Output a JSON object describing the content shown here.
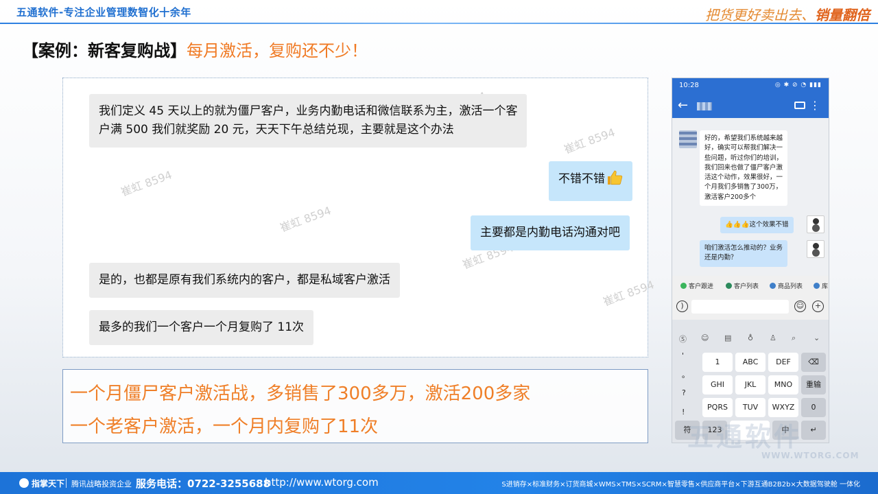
{
  "header": {
    "brand": "五通软件-专注企业管理数智化十余年",
    "slogan_normal": "把货更好卖出去、",
    "slogan_bold": "销量翻倍",
    "title_main": "【案例：新客复购战】",
    "title_sub": "每月激活，复购还不少！"
  },
  "chat": {
    "messages": [
      {
        "side": "left",
        "lines": [
          "我们定义 45 天以上的就为僵尸客户，业务内勤电话和微信联系为主，激活一个客",
          "户满 500 我们就奖励 20 元，天天下午总结兑现，主要就是这个办法"
        ]
      },
      {
        "side": "right",
        "lines": [
          "不错不错"
        ],
        "emoji": "thumbs-up"
      },
      {
        "side": "right",
        "lines": [
          "主要都是内勤电话沟通对吧"
        ]
      },
      {
        "side": "left",
        "lines": [
          "是的，也都是原有我们系统内的客户，都是私域客户激活"
        ]
      },
      {
        "side": "left",
        "lines": [
          "最多的我们一个客户一个月复购了 11次"
        ]
      }
    ],
    "watermark": "崔虹 8594"
  },
  "summary": {
    "line1": "一个月僵尸客户激活战，多销售了300多万，激活200多家",
    "line2": "一个老客户激活，一个月内复购了11次"
  },
  "phone": {
    "status_time": "10:28",
    "status_icons": "◎ ✱ ⊘ ◔ ▮▮▮",
    "messages": [
      {
        "side": "left",
        "lines": [
          "好的，希望我们系统越来越",
          "好，确实可以帮我们解决一",
          "些问题，听过你们的培训，",
          "我们回来也做了僵尸客户激",
          "活这个动作，效果很好，一",
          "个月我们多销售了300万，",
          "激活客户200多个"
        ]
      },
      {
        "side": "right",
        "lines": [
          "👍👍👍这个效果不错"
        ]
      },
      {
        "side": "right",
        "lines": [
          "咱们激活怎么推动的？业务",
          "还是内勤？"
        ]
      }
    ],
    "actions": [
      "客户跟进",
      "客户列表",
      "商品列表",
      "库"
    ],
    "keyboard": {
      "punct": [
        "'",
        "。",
        "?",
        "!"
      ],
      "row1": [
        "1",
        "ABC",
        "DEF"
      ],
      "row2": [
        "GHI",
        "JKL",
        "MNO"
      ],
      "row3": [
        "PQRS",
        "TUV",
        "WXYZ"
      ],
      "bottom": [
        "符",
        "123",
        "中",
        "↵"
      ],
      "side_keys": [
        "⌫",
        "重输",
        "0"
      ]
    }
  },
  "footer": {
    "logo": "指掌天下",
    "invest": "腾讯战略投资企业",
    "phone": "服务电话：0722-3255688",
    "url": "http://www.wtorg.com",
    "products": "S进销存×标准财务×订货商城×WMS×TMS×SCRM×智慧零售×供应商平台×下游互通B2B2b×大数据驾驶舱 一体化"
  },
  "background": {
    "logo": "五通软件",
    "logo_url": "WWW.WTORG.COM"
  },
  "colors": {
    "accent": "#f07a24",
    "brand_blue": "#1f6fd0",
    "bubble_right": "#c6e6fb",
    "bubble_left": "#ececec"
  }
}
